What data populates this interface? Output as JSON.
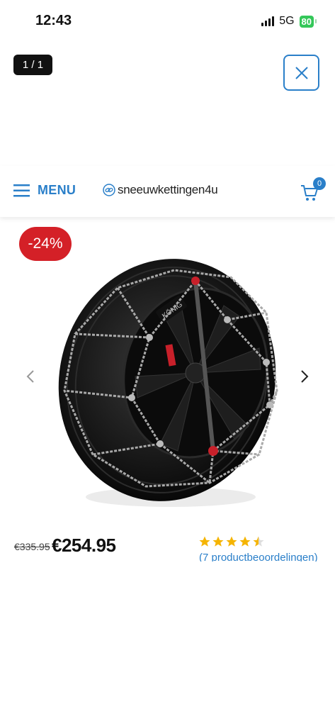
{
  "status_bar": {
    "time": "12:43",
    "network": "5G",
    "battery": "80"
  },
  "gallery": {
    "counter": "1 / 1",
    "close_icon": "close-icon"
  },
  "header": {
    "menu_label": "MENU",
    "logo_text": "sneeuwkettingen4u",
    "cart_count": "0"
  },
  "product": {
    "discount": "-24%",
    "old_price": "€335.95",
    "price": "€254.95",
    "rating": 4.5,
    "reviews_label": "(7 productbeoordelingen)",
    "image_brand_text": "KÖNIG"
  },
  "colors": {
    "accent": "#2a7fc9",
    "discount": "#d42027",
    "stars": "#f5b400"
  }
}
